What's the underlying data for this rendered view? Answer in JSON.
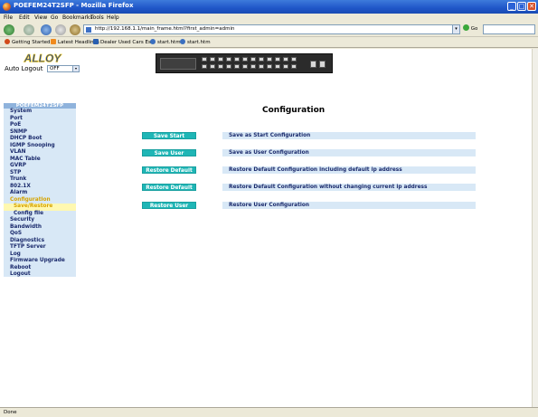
{
  "window": {
    "title": "POEFEM24T2SFP - Mozilla Firefox"
  },
  "menu": [
    "File",
    "Edit",
    "View",
    "Go",
    "Bookmarks",
    "Tools",
    "Help"
  ],
  "nav": {
    "url": "http://192.168.1.1/main_frame.html?first_admin=admin",
    "go_label": "Go"
  },
  "bookmarks": [
    "Getting Started",
    "Latest Headlines",
    "Dealer Used Cars Es...",
    "start.htm",
    "start.htm"
  ],
  "header": {
    "logo_text": "ALLOY",
    "auto_logout_label": "Auto Logout",
    "auto_logout_value": "OFF"
  },
  "sidebar": {
    "title": "POEFEM24T2SFP",
    "items": [
      {
        "label": "System"
      },
      {
        "label": "Port"
      },
      {
        "label": "PoE"
      },
      {
        "label": "SNMP"
      },
      {
        "label": "DHCP Boot"
      },
      {
        "label": "IGMP Snooping"
      },
      {
        "label": "VLAN"
      },
      {
        "label": "MAC Table"
      },
      {
        "label": "GVRP"
      },
      {
        "label": "STP"
      },
      {
        "label": "Trunk"
      },
      {
        "label": "802.1X"
      },
      {
        "label": "Alarm"
      },
      {
        "label": "Configuration"
      },
      {
        "label": "Save/Restore"
      },
      {
        "label": "Config file"
      },
      {
        "label": "Security"
      },
      {
        "label": "Bandwidth"
      },
      {
        "label": "QoS"
      },
      {
        "label": "Diagnostics"
      },
      {
        "label": "TFTP Server"
      },
      {
        "label": "Log"
      },
      {
        "label": "Firmware Upgrade"
      },
      {
        "label": "Reboot"
      },
      {
        "label": "Logout"
      }
    ]
  },
  "main": {
    "title": "Configuration",
    "rows": [
      {
        "button": "Save Start",
        "description": "Save as Start Configuration"
      },
      {
        "button": "Save User",
        "description": "Save as User Configuration"
      },
      {
        "button": "Restore Default",
        "description": "Restore Default Configuration including default ip address"
      },
      {
        "button": "Restore Default",
        "description": "Restore Default Configuration without changing current ip address"
      },
      {
        "button": "Restore User",
        "description": "Restore User Configuration"
      }
    ]
  },
  "status": {
    "text": "Done"
  },
  "colors": {
    "accent_button": "#1fb6b6",
    "row_bg": "#d8e8f6",
    "sidebar_text": "#1a2a6c",
    "active_item": "#d6a400"
  }
}
